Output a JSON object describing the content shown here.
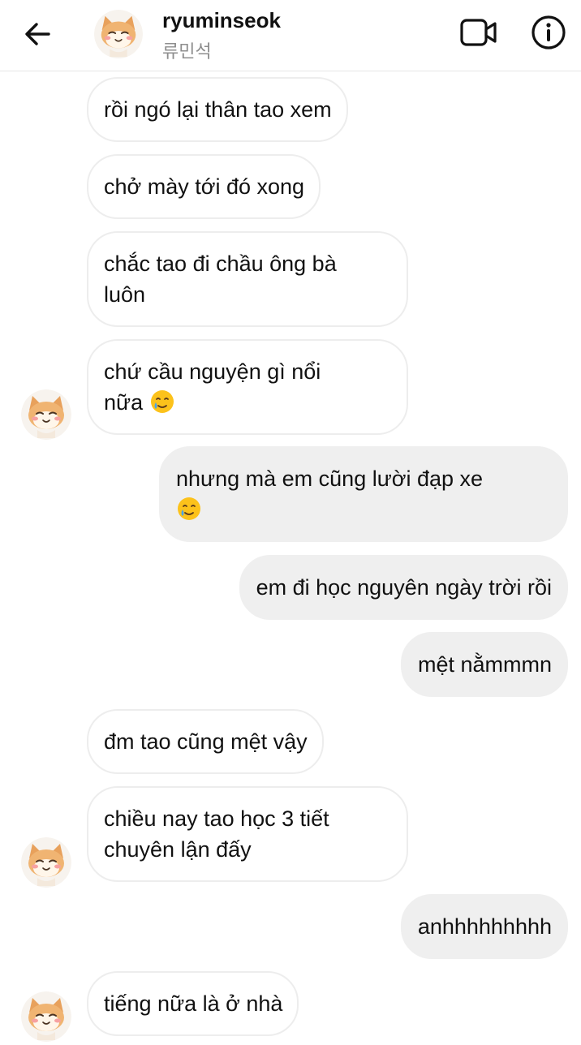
{
  "header": {
    "username": "ryuminseok",
    "display_name": "류민석"
  },
  "icons": {
    "back": "arrow-left-icon",
    "video": "video-camera-icon",
    "info": "info-circle-icon"
  },
  "messages": [
    {
      "side": "in",
      "text": "rồi ngó lại thân tao xem"
    },
    {
      "side": "in",
      "text": "chở mày tới đó xong"
    },
    {
      "side": "in",
      "line1": "chắc tao đi chầu ông bà",
      "line2": "luôn"
    },
    {
      "side": "in",
      "line1": "chứ cầu nguyện gì nổi",
      "line2": "nữa",
      "emoji": "smiling-face-with-tear"
    },
    {
      "side": "out",
      "line1": "nhưng mà em cũng lười đạp xe",
      "emoji": "smiling-face-with-tear"
    },
    {
      "side": "out",
      "text": "em đi học nguyên ngày trời rồi"
    },
    {
      "side": "out",
      "text": "mệt nằmmmn"
    },
    {
      "side": "in",
      "text": "đm tao cũng mệt vậy"
    },
    {
      "side": "in",
      "line1": "chiều nay tao học 3 tiết",
      "line2": "chuyên lận đấy"
    },
    {
      "side": "out",
      "text": "anhhhhhhhhh"
    },
    {
      "side": "in",
      "text": "tiếng nữa là ở nhà"
    }
  ]
}
